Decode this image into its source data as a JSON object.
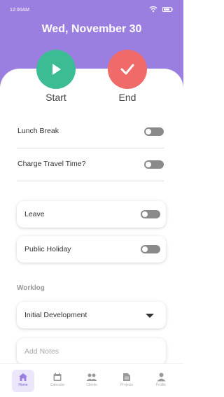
{
  "status_bar": {
    "time": "12:00AM"
  },
  "header": {
    "date": "Wed, November 30"
  },
  "actions": {
    "start_label": "Start",
    "end_label": "End"
  },
  "toggles": {
    "lunch_break": {
      "label": "Lunch Break",
      "on": false
    },
    "charge_travel": {
      "label": "Charge Travel Time?",
      "on": false
    },
    "leave": {
      "label": "Leave",
      "on": false
    },
    "public_holiday": {
      "label": "Public Holiday",
      "on": false
    }
  },
  "worklog": {
    "title": "Worklog",
    "selected": "Initial Development",
    "notes_placeholder": "Add Notes"
  },
  "nav": [
    {
      "label": "Home",
      "icon": "home-icon",
      "active": true
    },
    {
      "label": "Calendar",
      "icon": "calendar-icon",
      "active": false
    },
    {
      "label": "Clients",
      "icon": "clients-icon",
      "active": false
    },
    {
      "label": "Projects",
      "icon": "projects-icon",
      "active": false
    },
    {
      "label": "Profile",
      "icon": "profile-icon",
      "active": false
    }
  ],
  "colors": {
    "header": "#9b7fe0",
    "start": "#3cbc95",
    "end": "#f06a6a",
    "accent": "#7a5cd6"
  }
}
